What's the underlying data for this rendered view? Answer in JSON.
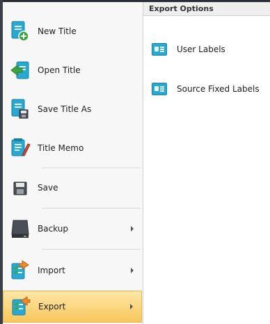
{
  "menu": {
    "items": [
      {
        "label": "New Title",
        "icon": "new-title-icon"
      },
      {
        "label": "Open Title",
        "icon": "open-title-icon"
      },
      {
        "label": "Save Title As",
        "icon": "save-title-as-icon"
      },
      {
        "label": "Title Memo",
        "icon": "title-memo-icon"
      },
      {
        "label": "Save",
        "icon": "save-icon"
      },
      {
        "label": "Backup",
        "icon": "backup-icon"
      },
      {
        "label": "Import",
        "icon": "import-icon"
      },
      {
        "label": "Export",
        "icon": "export-icon"
      }
    ]
  },
  "submenu": {
    "header": "Export Options",
    "options": [
      {
        "label": "User Labels",
        "icon": "user-labels-icon"
      },
      {
        "label": "Source Fixed Labels",
        "icon": "source-fixed-labels-icon"
      }
    ]
  },
  "colors": {
    "accent": "#27a9d3",
    "selected_top": "#fde8a8",
    "selected_bottom": "#f9c65a"
  }
}
